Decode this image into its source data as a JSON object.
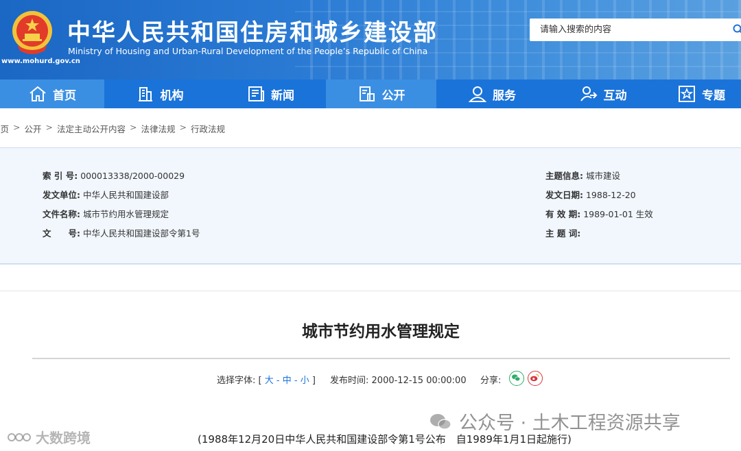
{
  "header": {
    "title": "中华人民共和国住房和城乡建设部",
    "subtitle": "Ministry of Housing and Urban-Rural Development of the People’s Republic of China",
    "url": "www.mohurd.gov.cn",
    "search_placeholder": "请输入搜索的内容"
  },
  "nav": {
    "items": [
      {
        "label": "首页",
        "icon": "home-icon"
      },
      {
        "label": "机构",
        "icon": "building-icon"
      },
      {
        "label": "新闻",
        "icon": "news-icon"
      },
      {
        "label": "公开",
        "icon": "document-icon"
      },
      {
        "label": "服务",
        "icon": "person-service-icon"
      },
      {
        "label": "互动",
        "icon": "interaction-icon"
      },
      {
        "label": "专题",
        "icon": "star-icon"
      }
    ]
  },
  "breadcrumb": [
    "首页",
    "公开",
    "法定主动公开内容",
    "法律法规",
    "行政法规"
  ],
  "info": {
    "index_no_label": "索 引 号:",
    "index_no": "000013338/2000-00029",
    "issuer_label": "发文单位:",
    "issuer": "中华人民共和国建设部",
    "doc_name_label": "文件名称:",
    "doc_name": "城市节约用水管理规定",
    "doc_no_label": "文　　号:",
    "doc_no": "中华人民共和国建设部令第1号",
    "topic_label": "主题信息:",
    "topic": "城市建设",
    "date_label": "发文日期:",
    "date": "1988-12-20",
    "validity_label": "有 效 期:",
    "validity": "1989-01-01 生效",
    "keywords_label": "主 题 词:",
    "keywords": ""
  },
  "article": {
    "title": "城市节约用水管理规定",
    "font_label": "选择字体:",
    "font_options": [
      "大",
      "中",
      "小"
    ],
    "publish_label": "发布时间:",
    "publish_time": "2000-12-15 00:00:00",
    "share_label": "分享:",
    "promulgation": "(1988年12月20日中华人民共和国建设部令第1号公布　自1989年1月1日起施行)"
  },
  "watermarks": {
    "left": "大数跨境",
    "right": "公众号 · 土木工程资源共享"
  },
  "colors": {
    "header_blue": "#1a67c4",
    "nav_blue": "#1a73d9",
    "nav_active": "#3a8fe3",
    "info_bg": "#f1f7fd",
    "link_blue": "#1a73d9"
  }
}
